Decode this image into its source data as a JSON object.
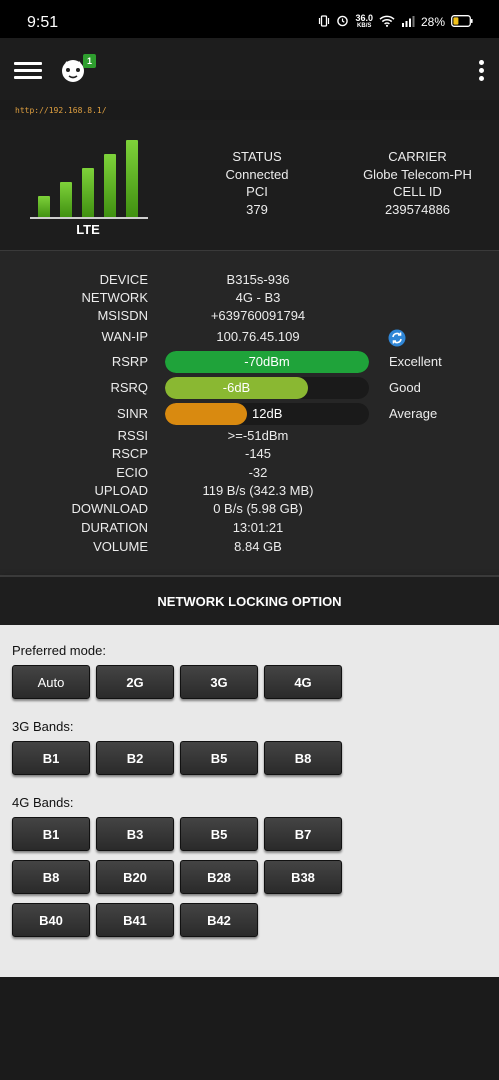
{
  "status_bar": {
    "time": "9:51",
    "net_speed_value": "36.0",
    "net_speed_unit": "KB/S",
    "battery": "28%"
  },
  "app_bar": {
    "notification_count": "1"
  },
  "url": "http://192.168.8.1/",
  "signal": {
    "label": "LTE",
    "bars_level": 5,
    "bars_total": 5
  },
  "summary": {
    "status_label": "STATUS",
    "status_value": "Connected",
    "pci_label": "PCI",
    "pci_value": "379",
    "carrier_label": "CARRIER",
    "carrier_value": "Globe Telecom-PH",
    "cellid_label": "CELL ID",
    "cellid_value": "239574886"
  },
  "info": {
    "device_label": "DEVICE",
    "device_value": "B315s-936",
    "network_label": "NETWORK",
    "network_value": "4G - B3",
    "msisdn_label": "MSISDN",
    "msisdn_value": "+639760091794",
    "wanip_label": "WAN-IP",
    "wanip_value": "100.76.45.109",
    "rsrp_label": "RSRP",
    "rsrp_value": "-70dBm",
    "rsrp_quality": "Excellent",
    "rsrp_level": 1.0,
    "rsrp_color": "#1fa33a",
    "rsrq_label": "RSRQ",
    "rsrq_value": "-6dB",
    "rsrq_quality": "Good",
    "rsrq_level": 0.7,
    "rsrq_color": "#8ab832",
    "sinr_label": "SINR",
    "sinr_value": "12dB",
    "sinr_quality": "Average",
    "sinr_level": 0.4,
    "sinr_color": "#d98a10",
    "rssi_label": "RSSI",
    "rssi_value": ">=-51dBm",
    "rscp_label": "RSCP",
    "rscp_value": "-145",
    "ecio_label": "ECIO",
    "ecio_value": "-32",
    "upload_label": "UPLOAD",
    "upload_value": "119 B/s (342.3 MB)",
    "download_label": "DOWNLOAD",
    "download_value": "0 B/s (5.98 GB)",
    "duration_label": "DURATION",
    "duration_value": "13:01:21",
    "volume_label": "VOLUME",
    "volume_value": "8.84 GB"
  },
  "locking": {
    "title": "NETWORK LOCKING OPTION",
    "preferred_mode_title": "Preferred mode:",
    "preferred_modes": [
      "Auto",
      "2G",
      "3G",
      "4G"
    ],
    "bands_3g_title": "3G Bands:",
    "bands_3g": [
      "B1",
      "B2",
      "B5",
      "B8"
    ],
    "bands_4g_title": "4G Bands:",
    "bands_4g": [
      "B1",
      "B3",
      "B5",
      "B7",
      "B8",
      "B20",
      "B28",
      "B38",
      "B40",
      "B41",
      "B42"
    ]
  }
}
